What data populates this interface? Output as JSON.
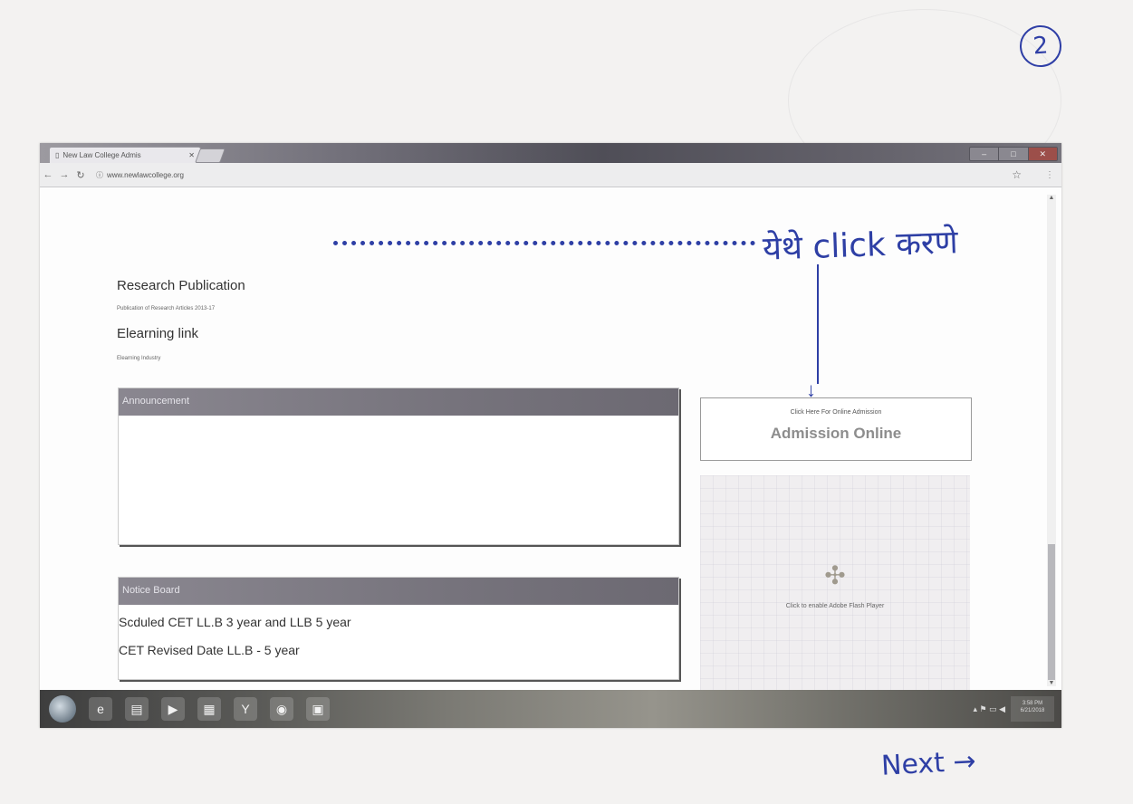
{
  "page": {
    "page_number": "2",
    "handwritten_note": "येथे click करणे",
    "next_label": "Next →"
  },
  "browser": {
    "tab_title": "New Law College Admis",
    "url": "www.newlawcollege.org"
  },
  "content": {
    "research_title": "Research Publication",
    "research_sub": "Publication of Research Articles 2013-17",
    "elearning_title": "Elearning link",
    "elearning_sub": "Elearning Industry",
    "announcement_header": "Announcement",
    "notice_header": "Notice Board",
    "notice_items": [
      "Scduled CET LL.B 3 year and LLB 5 year",
      "CET Revised Date LL.B - 5 year"
    ],
    "admission_small": "Click Here For Online Admission",
    "admission_big": "Admission Online",
    "flash_message": "Click to enable Adobe Flash Player"
  },
  "taskbar": {
    "time": "3:58 PM",
    "date": "6/21/2018"
  }
}
